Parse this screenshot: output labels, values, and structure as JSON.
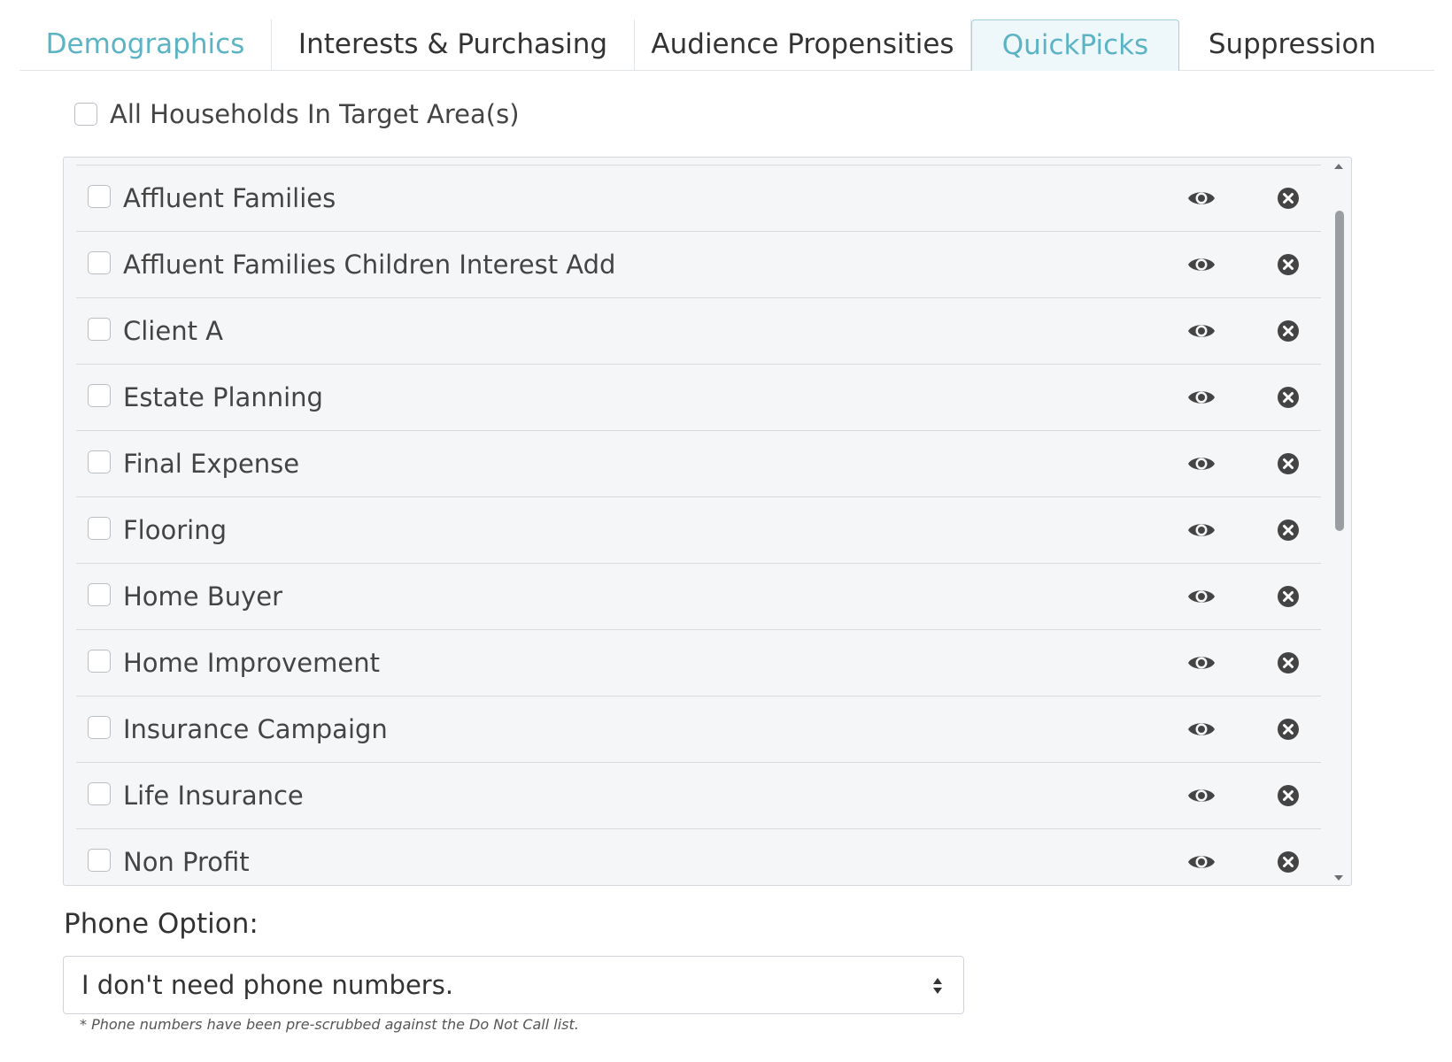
{
  "tabs": [
    {
      "label": "Demographics"
    },
    {
      "label": "Interests & Purchasing"
    },
    {
      "label": "Audience Propensities"
    },
    {
      "label": "QuickPicks"
    },
    {
      "label": "Suppression"
    }
  ],
  "all_households": {
    "label": "All Households In Target Area(s)",
    "checked": false
  },
  "quickpicks": {
    "items": [
      {
        "label": "Affluent Families"
      },
      {
        "label": "Affluent Families Children Interest Add"
      },
      {
        "label": "Client A"
      },
      {
        "label": "Estate Planning"
      },
      {
        "label": "Final Expense"
      },
      {
        "label": "Flooring"
      },
      {
        "label": "Home Buyer"
      },
      {
        "label": "Home Improvement"
      },
      {
        "label": "Insurance Campaign"
      },
      {
        "label": "Life Insurance"
      },
      {
        "label": "Non Profit"
      }
    ],
    "row_icons": [
      "eye-icon",
      "close-circle-icon"
    ]
  },
  "phone_option": {
    "label": "Phone Option:",
    "selected": "I don't need phone numbers.",
    "note": "* Phone numbers have been pre-scrubbed against the Do Not Call list."
  },
  "colors": {
    "accent_teal": "#5bb3c4",
    "active_tab_bg": "#eef7fa",
    "panel_bg": "#f5f6f8",
    "icon_dark": "#444444"
  }
}
